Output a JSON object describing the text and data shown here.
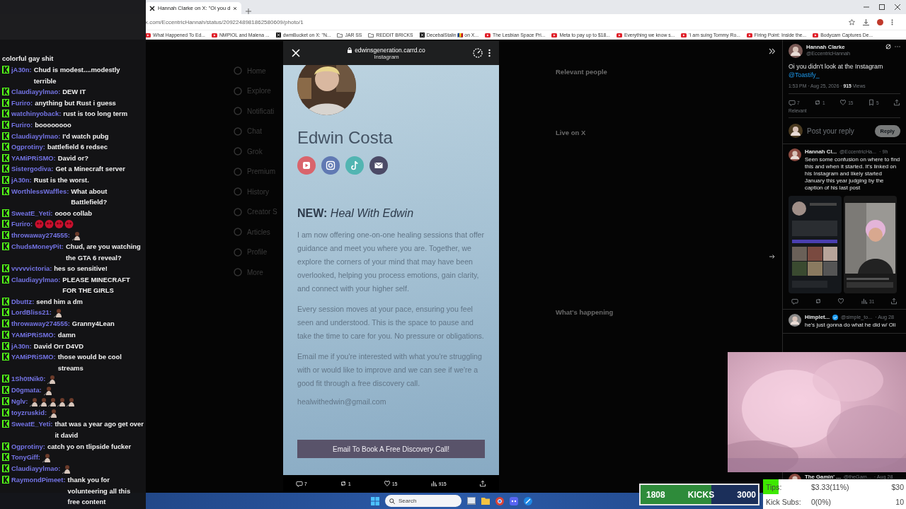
{
  "browser": {
    "tabs": [
      {
        "title": "Hannah Clarke on X: \"Oi you d",
        "selected": true
      }
    ],
    "address": "x.com/EccentricHannah/status/2092248981862580609/photo/1",
    "bookmarks": [
      {
        "label": "What Happened To Ed...",
        "kind": "video"
      },
      {
        "label": "NMPIOL and Malena ...",
        "kind": "video"
      },
      {
        "label": "dwmBucket on X: \"N...",
        "kind": "x"
      },
      {
        "label": "JAR SS",
        "kind": "folder"
      },
      {
        "label": "REDDIT BRICKS",
        "kind": "folder"
      },
      {
        "label": "DecebalStalin 🇷🇴 on X...",
        "kind": "x"
      },
      {
        "label": "The Lesbian Space Pri...",
        "kind": "video"
      },
      {
        "label": "Meta to pay up to $18...",
        "kind": "video"
      },
      {
        "label": "Everything we know s...",
        "kind": "video"
      },
      {
        "label": "'I am suing Tommy Ro...",
        "kind": "video"
      },
      {
        "label": "Firing Point: Inside the...",
        "kind": "video"
      },
      {
        "label": "Bodycam Captures De...",
        "kind": "video"
      }
    ]
  },
  "x_nav": [
    "Home",
    "Explore",
    "Notificati",
    "Chat",
    "Grok",
    "Premium",
    "History",
    "Creator S",
    "Articles",
    "Profile",
    "More"
  ],
  "x_side_headings": [
    "Relevant people",
    "Live on X",
    "What's happening"
  ],
  "modal": {
    "host": "edwinsgeneration.carrd.co",
    "subtitle": "Instagram",
    "name": "Edwin Costa",
    "socials": [
      {
        "kind": "youtube",
        "color": "#d9646c"
      },
      {
        "kind": "instagram",
        "color": "#6079b3"
      },
      {
        "kind": "tiktok",
        "color": "#52b5b2"
      },
      {
        "kind": "email",
        "color": "#4b4a66"
      }
    ],
    "heading": "**NEW:** *Heal With Edwin*",
    "paragraphs": [
      "I am now offering one-on-one healing sessions that offer guidance and meet you where you are. Together, we explore the corners of your mind that may have been overlooked, helping you process emotions, gain clarity, and connect with your higher self.",
      "Every session moves at your pace, ensuring you feel seen and understood. This is the space to pause and take the time to care for you. No pressure or obligations.",
      "Email me if you're interested with what you're struggling with or would like to improve and we can see if we're a good fit through a free discovery call."
    ],
    "email": "healwithedwin@gmail.com",
    "button": "Email To Book A Free Discovery Call!",
    "stats": [
      {
        "kind": "reply",
        "count": "7"
      },
      {
        "kind": "repost",
        "count": "1"
      },
      {
        "kind": "like",
        "count": "15"
      },
      {
        "kind": "views",
        "count": "915"
      },
      {
        "kind": "share"
      }
    ]
  },
  "chat": [
    {
      "text": "colorful gay shit"
    },
    {
      "user": "jA30n:",
      "text": "Chud is modest....modestly terrible"
    },
    {
      "user": "Claudiayylmao:",
      "text": "DEW IT"
    },
    {
      "user": "Furiro:",
      "text": "anything but Rust i guess"
    },
    {
      "user": "watchinyoback:",
      "text": "rust is too long term"
    },
    {
      "user": "Furiro:",
      "text": "boooooooo"
    },
    {
      "user": "Claudiayylmao:",
      "text": "I'd watch pubg"
    },
    {
      "user": "Ogprotiny:",
      "text": "battlefield 6 redsec"
    },
    {
      "user": "YAMiPRiSMO:",
      "text": "David or?"
    },
    {
      "user": "Sistergodiva:",
      "text": "Get a Minecraft server"
    },
    {
      "user": "jA30n:",
      "text": "Rust is the worst."
    },
    {
      "user": "WorthlessWaffles:",
      "text": "What about Battlefield?"
    },
    {
      "user": "SweatE_Yeti:",
      "text": "oooo collab"
    },
    {
      "user": "Furiro:",
      "emotes": [
        {
          "kind": "blob"
        },
        {
          "kind": "blob"
        },
        {
          "kind": "blob"
        },
        {
          "kind": "blob"
        }
      ]
    },
    {
      "user": "throwaway274555:",
      "emotes": [
        {
          "kind": "figure"
        }
      ]
    },
    {
      "user": "ChudsMoneyPit:",
      "text": "Chud, are you watching the GTA 6 reveal?"
    },
    {
      "user": "vvvvvictoria:",
      "text": "hes so sensitive!"
    },
    {
      "user": "Claudiayylmao:",
      "text": "PLEASE MINECRAFT FOR THE GIRLS"
    },
    {
      "user": "Dbuttz:",
      "text": "send him a dm"
    },
    {
      "user": "LordBliss21:",
      "emotes": [
        {
          "kind": "figure"
        }
      ]
    },
    {
      "user": "throwaway274555:",
      "text": "Granny4Lean"
    },
    {
      "user": "YAMiPRiSMO:",
      "text": "damn"
    },
    {
      "user": "jA30n:",
      "text": "David Orr D4VD"
    },
    {
      "user": "YAMiPRiSMO:",
      "text": "those would be cool streams"
    },
    {
      "user": "1Sh0tNik0:",
      "emotes": [
        {
          "kind": "figure"
        }
      ]
    },
    {
      "user": "D0gmata:",
      "emotes": [
        {
          "kind": "figure"
        }
      ]
    },
    {
      "user": "Nglv:",
      "emotes": [
        {
          "kind": "figure"
        },
        {
          "kind": "figure"
        },
        {
          "kind": "figure"
        },
        {
          "kind": "figure"
        },
        {
          "kind": "figure"
        }
      ]
    },
    {
      "user": "toyzruskid:",
      "emotes": [
        {
          "kind": "figure"
        }
      ]
    },
    {
      "user": "SweatE_Yeti:",
      "text": "that was a year ago get over it david"
    },
    {
      "user": "Ogprotiny:",
      "text": "catch yo on tlipside fucker"
    },
    {
      "user": "TonyGiff:",
      "emotes": [
        {
          "kind": "figure"
        }
      ]
    },
    {
      "user": "Claudiayylmao:",
      "emotes": [
        {
          "kind": "figure"
        }
      ]
    },
    {
      "user": "RaymondPimeet:",
      "text": "thank you for volunteering all this free content"
    }
  ],
  "tweets": [
    {
      "kind": "main",
      "name": "Hannah Clarke",
      "handle": "@EccentricHannah",
      "text": "Oi you didn't look at the Instagram",
      "mention": "@Toastify_",
      "time": "1:53 PM · Aug 25, 2026 · ",
      "views": "915",
      "views_label": " Views",
      "stats": [
        "7",
        "1",
        "15",
        "5"
      ],
      "sort": "Relevant",
      "reply_placeholder": "Post your reply",
      "reply_button": "Reply"
    },
    {
      "kind": "reply",
      "name": "Hannah Cl...",
      "handle": "@EccentricHa...",
      "time": "· 9h",
      "text": "Seen some confusion on where to find this and when it started. It's linked on his Instagram and likely started January this year judging by the caption of his last post",
      "images": [
        {
          "kind": "picture"
        },
        {
          "kind": "picture"
        }
      ],
      "stats": [
        "31"
      ]
    },
    {
      "kind": "reply",
      "name": "Himplet...",
      "verified": true,
      "handle": "@simple_to...",
      "time": "· Aug 28",
      "text": "he's just gonna do what he did w/ Oli"
    },
    {
      "kind": "reply",
      "name": "The Gamin' ...",
      "handle": "@theGam...",
      "time": "· Aug 28"
    }
  ],
  "kicks_goal": {
    "current": "1808",
    "label": "KICKS",
    "target": "3000",
    "level": 0.603
  },
  "goals": [
    {
      "label": "Tips:",
      "value": "$3.33(11%)",
      "target": "$30",
      "level": 0.111
    },
    {
      "label": "Kick Subs:",
      "value": "0(0%)",
      "target": "10"
    }
  ],
  "taskbar": {
    "search": "Search"
  }
}
